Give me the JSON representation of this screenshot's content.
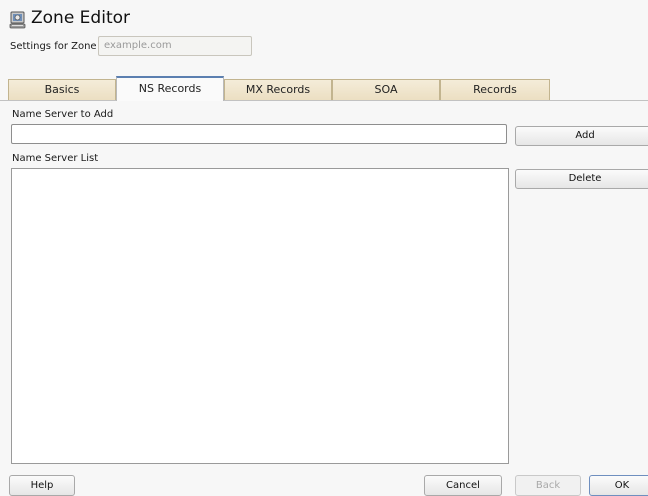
{
  "window": {
    "title": "Zone Editor",
    "icon": "network-globe-icon"
  },
  "zone": {
    "label": "Settings for Zone",
    "value": "example.com"
  },
  "tabs": [
    {
      "label": "Basics",
      "active": false
    },
    {
      "label": "NS Records",
      "active": true
    },
    {
      "label": "MX Records",
      "active": false
    },
    {
      "label": "SOA",
      "active": false
    },
    {
      "label": "Records",
      "active": false
    }
  ],
  "ns_add": {
    "label": "Name Server to Add",
    "value": "",
    "add_label": "Add"
  },
  "ns_list": {
    "label": "Name Server List",
    "items": [],
    "delete_label": "Delete"
  },
  "footer": {
    "help": "Help",
    "cancel": "Cancel",
    "back": "Back",
    "ok": "OK"
  },
  "colors": {
    "tab_inactive": "#ecdfc2",
    "tab_active_accent": "#5b7fb0",
    "background": "#f7f7f7"
  }
}
